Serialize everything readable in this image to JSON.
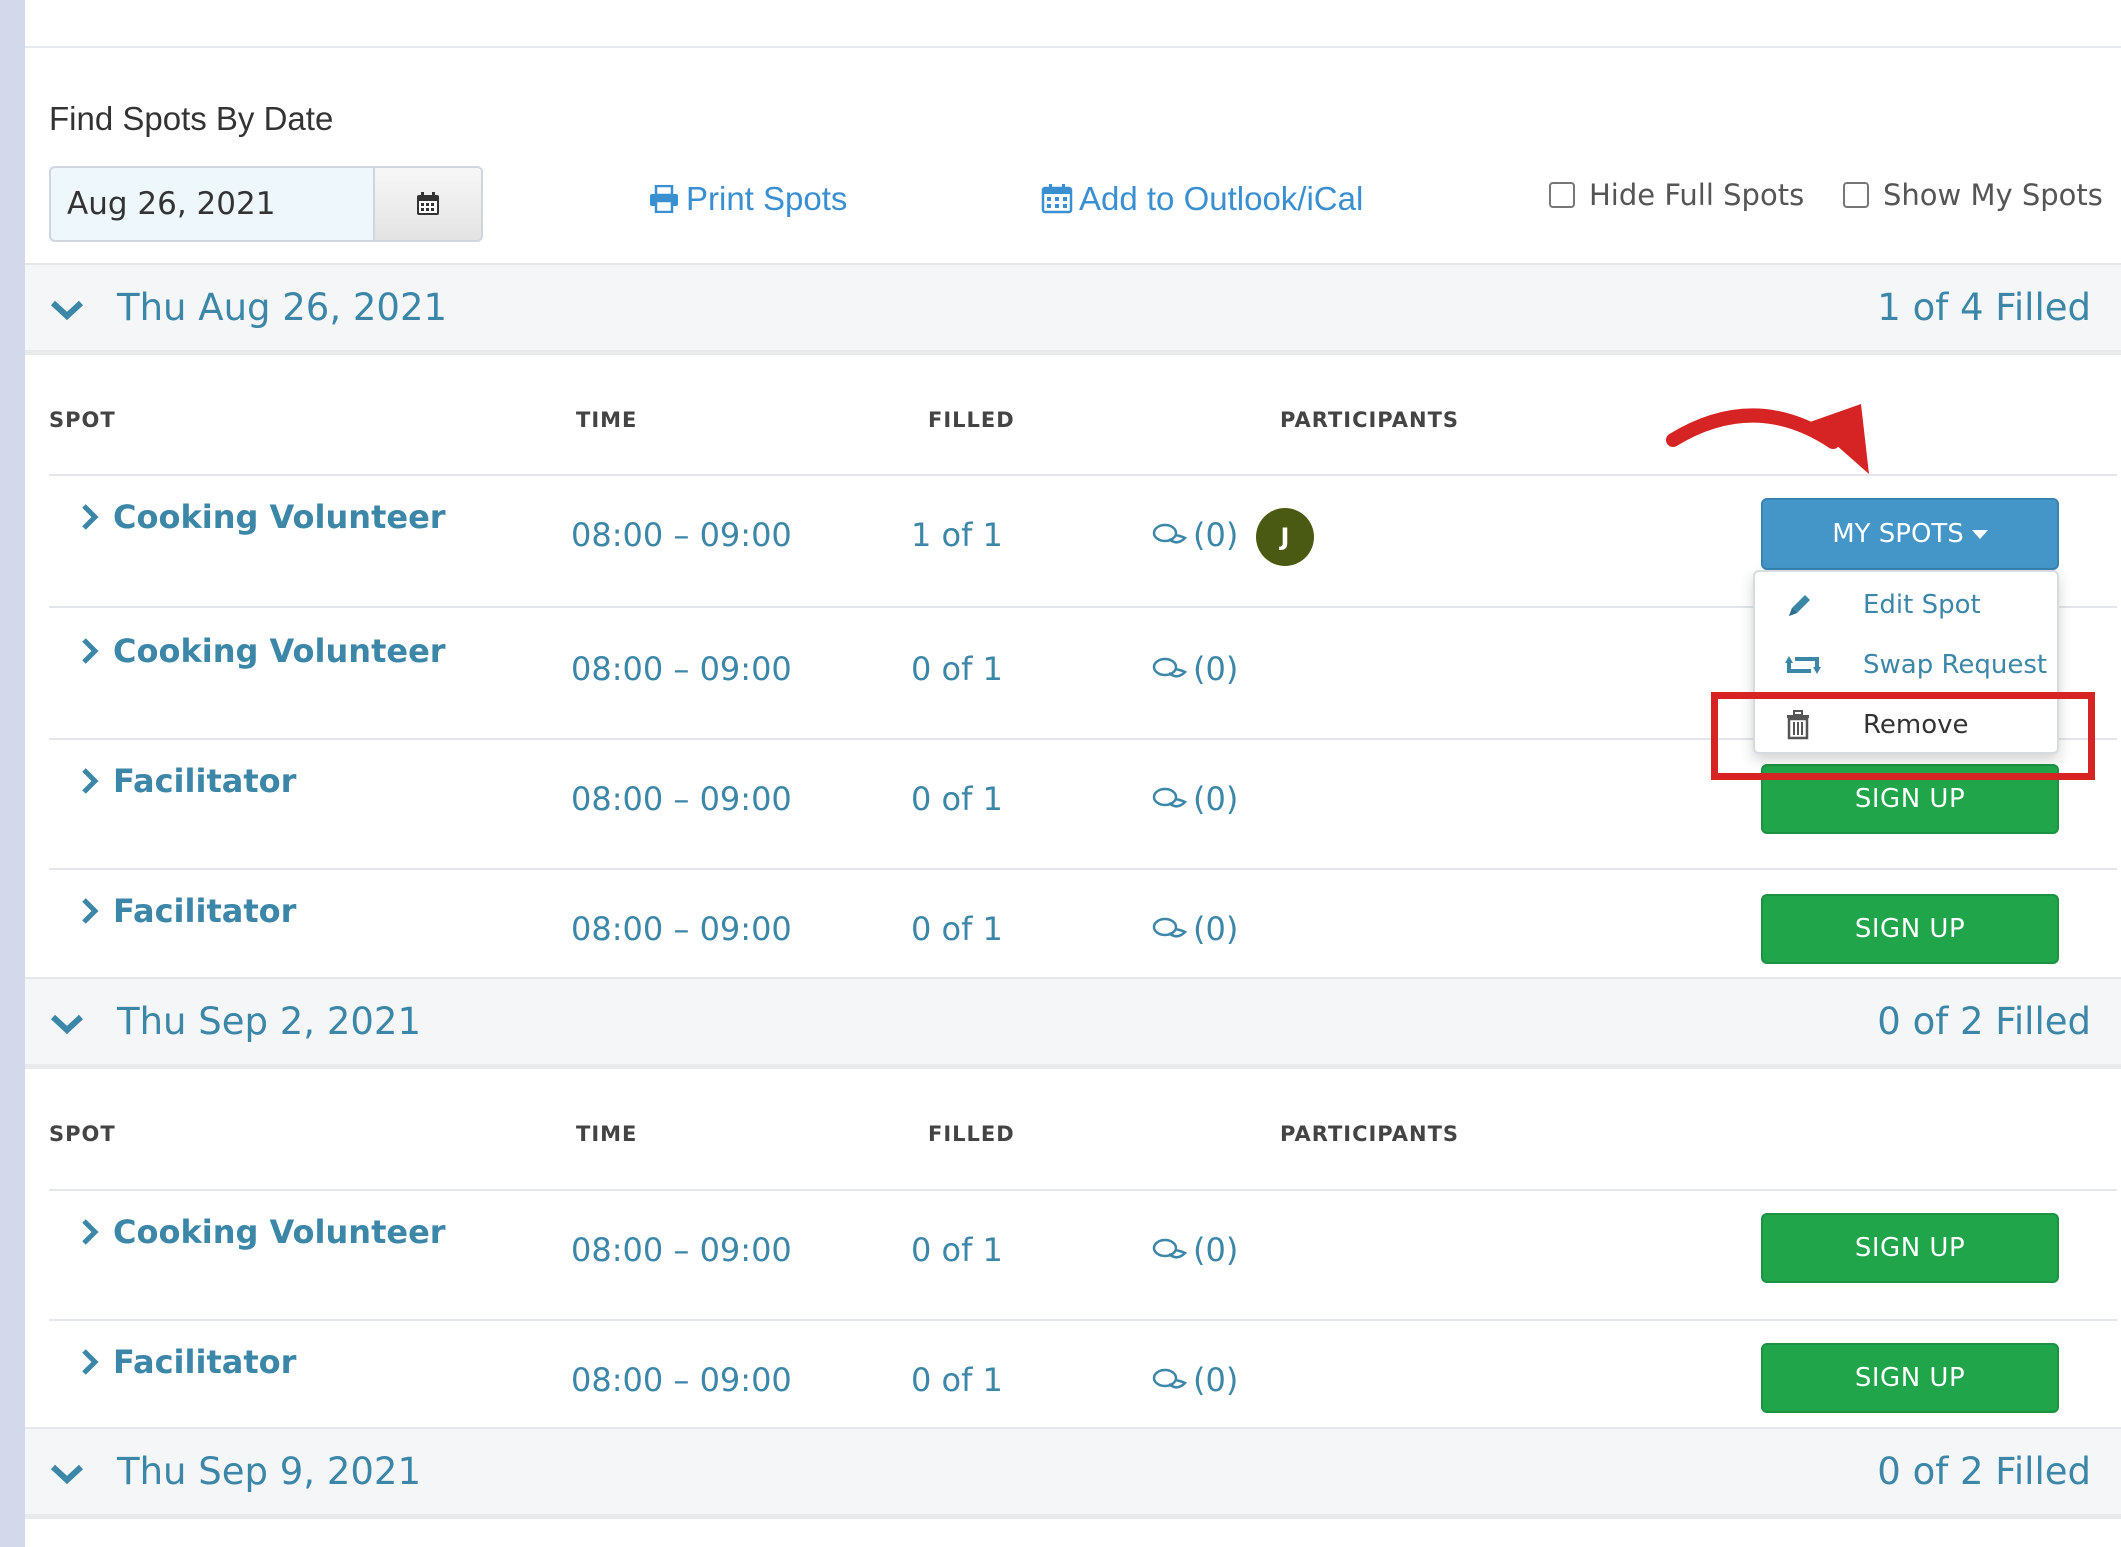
{
  "filter": {
    "find_label": "Find Spots By Date",
    "date_value": "Aug 26, 2021",
    "print_label": "Print Spots",
    "calendar_label": "Add to Outlook/iCal",
    "hide_full_label": "Hide Full Spots",
    "show_my_label": "Show My Spots"
  },
  "columns": {
    "spot": "SPOT",
    "time": "TIME",
    "filled": "FILLED",
    "participants": "PARTICIPANTS"
  },
  "groups": [
    {
      "date": "Thu Aug 26, 2021",
      "filled": "1 of 4 Filled",
      "rows": [
        {
          "name": "Cooking Volunteer",
          "time": "08:00 – 09:00",
          "filled": "1 of 1",
          "comments": "(0)",
          "participant_initial": "J",
          "action": "MY SPOTS"
        },
        {
          "name": "Cooking Volunteer",
          "time": "08:00 – 09:00",
          "filled": "0 of 1",
          "comments": "(0)"
        },
        {
          "name": "Facilitator",
          "time": "08:00 – 09:00",
          "filled": "0 of 1",
          "comments": "(0)",
          "action": "SIGN UP"
        },
        {
          "name": "Facilitator",
          "time": "08:00 – 09:00",
          "filled": "0 of 1",
          "comments": "(0)",
          "action": "SIGN UP"
        }
      ]
    },
    {
      "date": "Thu Sep 2, 2021",
      "filled": "0 of 2 Filled",
      "rows": [
        {
          "name": "Cooking Volunteer",
          "time": "08:00 – 09:00",
          "filled": "0 of 1",
          "comments": "(0)",
          "action": "SIGN UP"
        },
        {
          "name": "Facilitator",
          "time": "08:00 – 09:00",
          "filled": "0 of 1",
          "comments": "(0)",
          "action": "SIGN UP"
        }
      ]
    },
    {
      "date": "Thu Sep 9, 2021",
      "filled": "0 of 2 Filled"
    }
  ],
  "dropdown": {
    "edit": "Edit Spot",
    "swap": "Swap Request",
    "remove": "Remove"
  },
  "colors": {
    "accent": "#3c86a8",
    "link": "#3a8fd0",
    "signup_green": "#21a54b",
    "my_spots_blue": "#4596c8",
    "annotation_red": "#d62424"
  }
}
